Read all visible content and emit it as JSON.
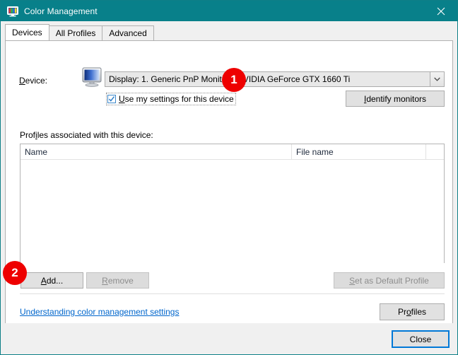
{
  "window": {
    "title": "Color Management",
    "icon": "color-monitor-icon",
    "close_icon": "close-icon",
    "accent_color": "#08808a"
  },
  "tabs": [
    {
      "label": "Devices",
      "active": true
    },
    {
      "label": "All Profiles",
      "active": false
    },
    {
      "label": "Advanced",
      "active": false
    }
  ],
  "device_section": {
    "label": "Device:",
    "icon": "monitor-icon",
    "selected_device": "Display: 1. Generic PnP Monitor - NVIDIA GeForce GTX 1660 Ti",
    "dropdown_icon": "chevron-down-icon",
    "use_my_settings_label": "Use my settings for this device",
    "use_my_settings_checked": true,
    "identify_monitors_label": "Identify monitors"
  },
  "profiles_section": {
    "caption": "Profiles associated with this device:",
    "columns": [
      "Name",
      "File name",
      ""
    ],
    "rows": [],
    "add_label": "Add...",
    "remove_label": "Remove",
    "remove_enabled": false,
    "set_default_label": "Set as Default Profile",
    "set_default_enabled": false
  },
  "footer_links": {
    "help_link": "Understanding color management settings",
    "profiles_label": "Profiles"
  },
  "dialog_buttons": {
    "close_label": "Close"
  },
  "annotations": {
    "badge_color": "#ee0000",
    "items": [
      {
        "number": "1",
        "target": "use-my-settings-checkbox"
      },
      {
        "number": "2",
        "target": "add-button"
      }
    ]
  }
}
